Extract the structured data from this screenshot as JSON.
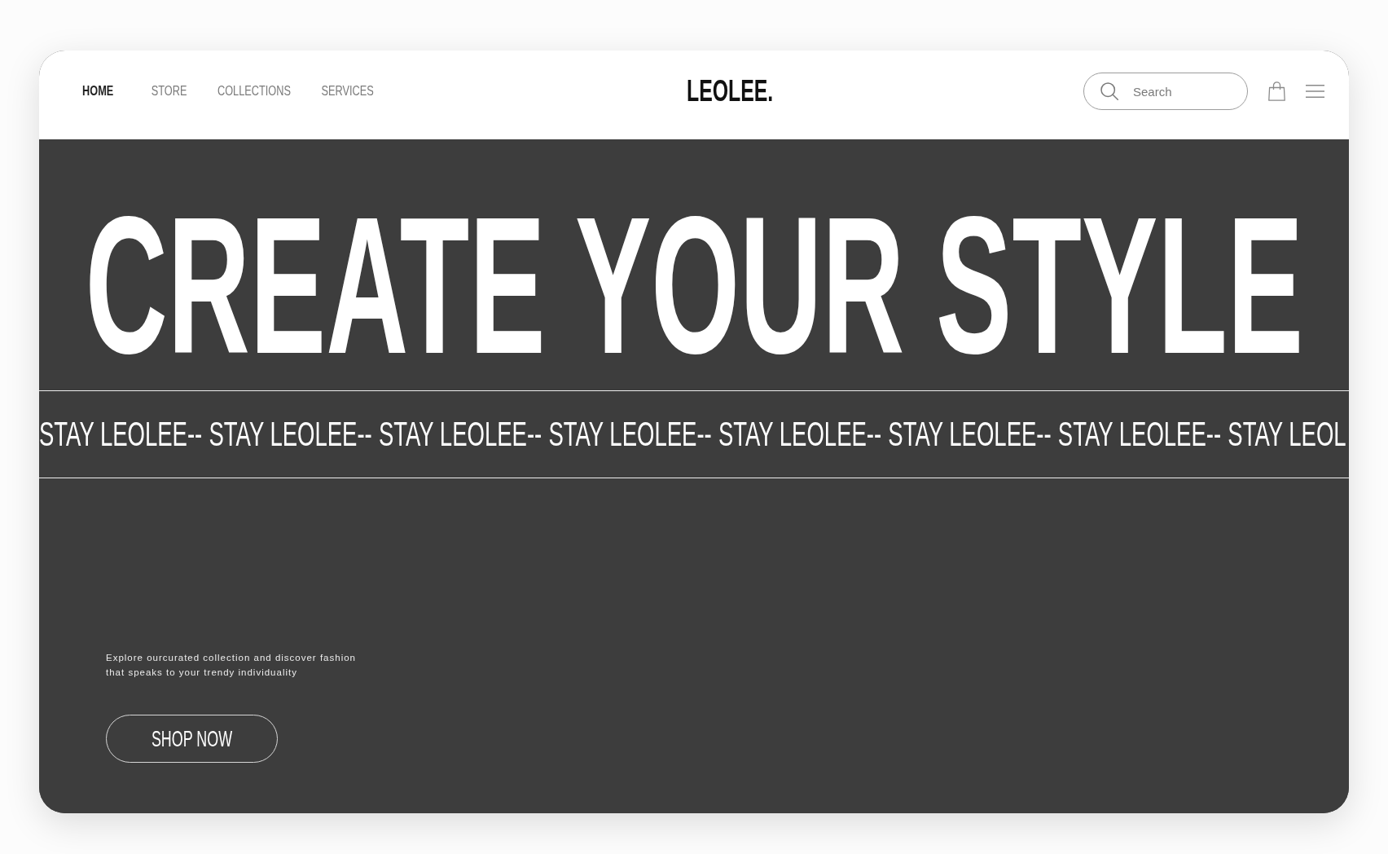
{
  "header": {
    "nav": [
      {
        "label": "HOME",
        "selected": true
      },
      {
        "label": "STORE",
        "selected": false
      },
      {
        "label": "COLLECTIONS",
        "selected": false
      },
      {
        "label": "SERVICES",
        "selected": false
      }
    ],
    "logo": "LEOLEE.",
    "search": {
      "placeholder": "Search"
    }
  },
  "hero": {
    "headline": "CREATE YOUR STYLE",
    "marquee": [
      "STAY LEOLEE--",
      "STAY LEOLEE--",
      "STAY LEOLEE--",
      "STAY LEOLEE--",
      "STAY LEOLEE--",
      "STAY LEOLEE--",
      "STAY LEOLEE--",
      "STAY LEOL"
    ],
    "description": "Explore ourcurated collection and discover fashion that speaks to your trendy individuality",
    "button": "SHOP NOW"
  }
}
